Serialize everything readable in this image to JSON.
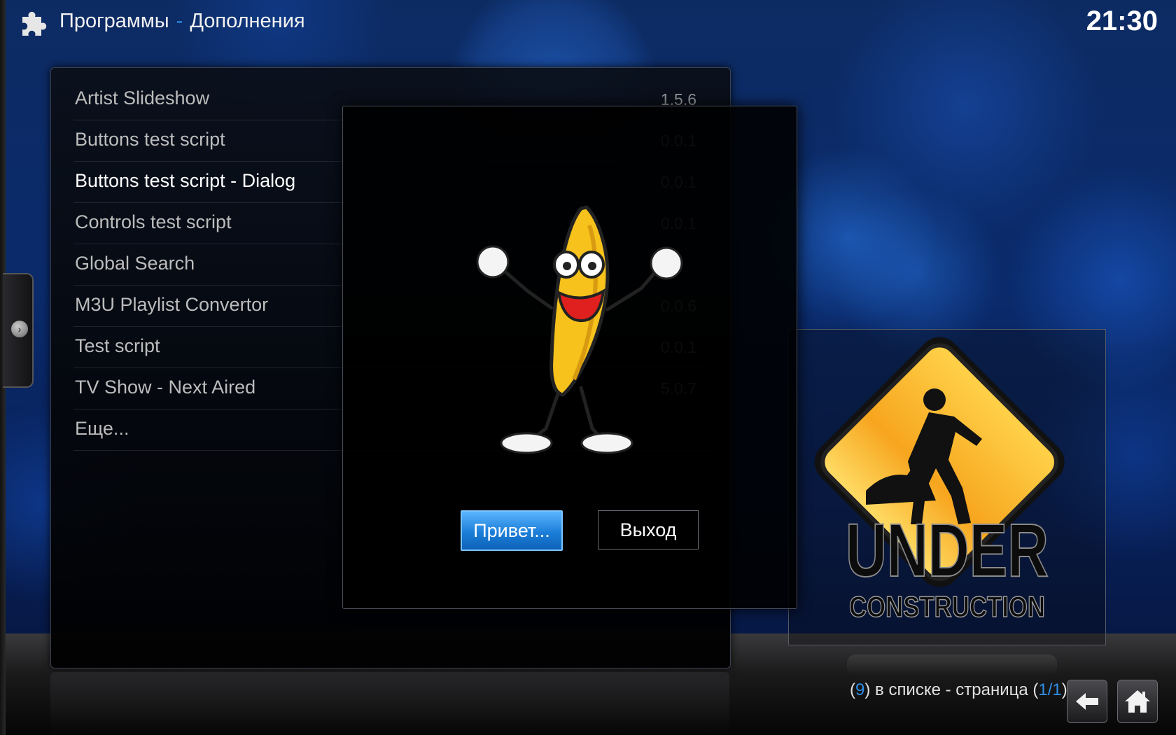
{
  "header": {
    "section": "Программы",
    "separator": "-",
    "subsection": "Дополнения",
    "clock": "21:30",
    "icon": "puzzle-icon"
  },
  "addons": [
    {
      "name": "Artist Slideshow",
      "version": "1.5.6"
    },
    {
      "name": "Buttons test script",
      "version": "0.0.1"
    },
    {
      "name": "Buttons test script - Dialog",
      "version": "0.0.1",
      "focused": true
    },
    {
      "name": "Controls test script",
      "version": "0.0.1"
    },
    {
      "name": "Global Search",
      "version": ""
    },
    {
      "name": "M3U Playlist Convertor",
      "version": "0.0.6"
    },
    {
      "name": "Test script",
      "version": "0.0.1"
    },
    {
      "name": "TV Show - Next Aired",
      "version": "5.0.7"
    },
    {
      "name": "Еще...",
      "version": ""
    }
  ],
  "dialog": {
    "image": "dancing-banana",
    "hello_button": "Привет...",
    "exit_button": "Выход"
  },
  "thumbnail": {
    "line1": "UNDER",
    "line2": "CONSTRUCTION"
  },
  "footer": {
    "open": "(",
    "count": "9",
    "in_list": ") в списке - страница (",
    "page": "1/1",
    "close": ")"
  },
  "colors": {
    "accent": "#2f8fe6",
    "background": "#0a2a6b",
    "panel": "#000000"
  }
}
